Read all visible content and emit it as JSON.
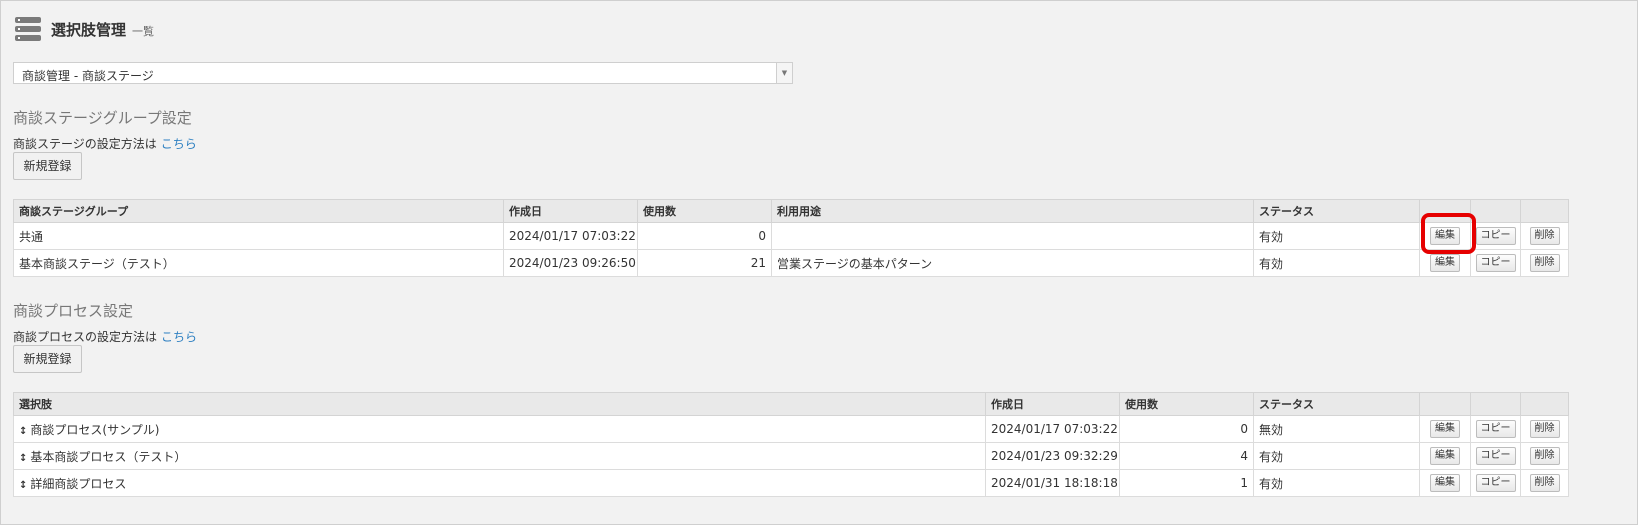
{
  "header": {
    "title": "選択肢管理",
    "subtitle": "一覧",
    "icon": "database-icon"
  },
  "selector": {
    "value": "商談管理 - 商談ステージ"
  },
  "stage_section": {
    "title": "商談ステージグループ設定",
    "desc": "商談ステージの設定方法は",
    "link": "こちら",
    "new_button": "新規登録",
    "columns": [
      "商談ステージグループ",
      "作成日",
      "使用数",
      "利用用途",
      "ステータス"
    ],
    "rows": [
      {
        "name": "共通",
        "created": "2024/01/17 07:03:22",
        "count": "0",
        "usage": "",
        "status": "有効"
      },
      {
        "name": "基本商談ステージ（テスト）",
        "created": "2024/01/23 09:26:50",
        "count": "21",
        "usage": "営業ステージの基本パターン",
        "status": "有効"
      }
    ]
  },
  "process_section": {
    "title": "商談プロセス設定",
    "desc": "商談プロセスの設定方法は",
    "link": "こちら",
    "new_button": "新規登録",
    "columns": [
      "選択肢",
      "作成日",
      "使用数",
      "ステータス"
    ],
    "rows": [
      {
        "name": "商談プロセス(サンプル)",
        "created": "2024/01/17 07:03:22",
        "count": "0",
        "status": "無効"
      },
      {
        "name": "基本商談プロセス（テスト）",
        "created": "2024/01/23 09:32:29",
        "count": "4",
        "status": "有効"
      },
      {
        "name": "詳細商談プロセス",
        "created": "2024/01/31 18:18:18",
        "count": "1",
        "status": "有効"
      }
    ]
  },
  "actions": {
    "edit": "編集",
    "copy": "コピー",
    "delete": "削除"
  },
  "colors": {
    "highlight": "#e60000",
    "link": "#2c7fc1"
  }
}
